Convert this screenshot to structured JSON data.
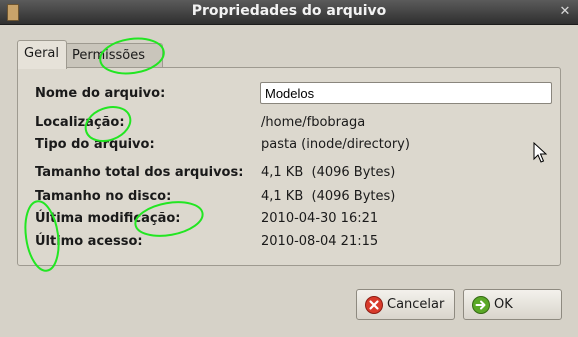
{
  "window": {
    "title": "Propriedades do arquivo",
    "close_glyph": "✕"
  },
  "tabs": [
    {
      "label": "Geral",
      "active": true
    },
    {
      "label": "Permissões",
      "active": false
    }
  ],
  "fields": {
    "name_label": "Nome do arquivo:",
    "name_value": "Modelos",
    "location_label": "Localização:",
    "location_value": "/home/fbobraga",
    "type_label": "Tipo do arquivo:",
    "type_value": "pasta (inode/directory)",
    "total_size_label": "Tamanho total dos arquivos:",
    "total_size_value": "4,1 KB  (4096 Bytes)",
    "disk_size_label": "Tamanho no disco:",
    "disk_size_value": "4,1 KB  (4096 Bytes)",
    "modified_label": "Última modificação:",
    "modified_value": "2010-04-30 16:21",
    "accessed_label": "Último acesso:",
    "accessed_value": "2010-08-04 21:15"
  },
  "buttons": {
    "cancel_label": "Cancelar",
    "cancel_icon": "cancel-icon",
    "ok_label": "OK",
    "ok_icon": "ok-icon"
  },
  "colors": {
    "annotation": "#22e622",
    "cancel_red": "#d83a2b",
    "ok_green": "#5aa826"
  }
}
